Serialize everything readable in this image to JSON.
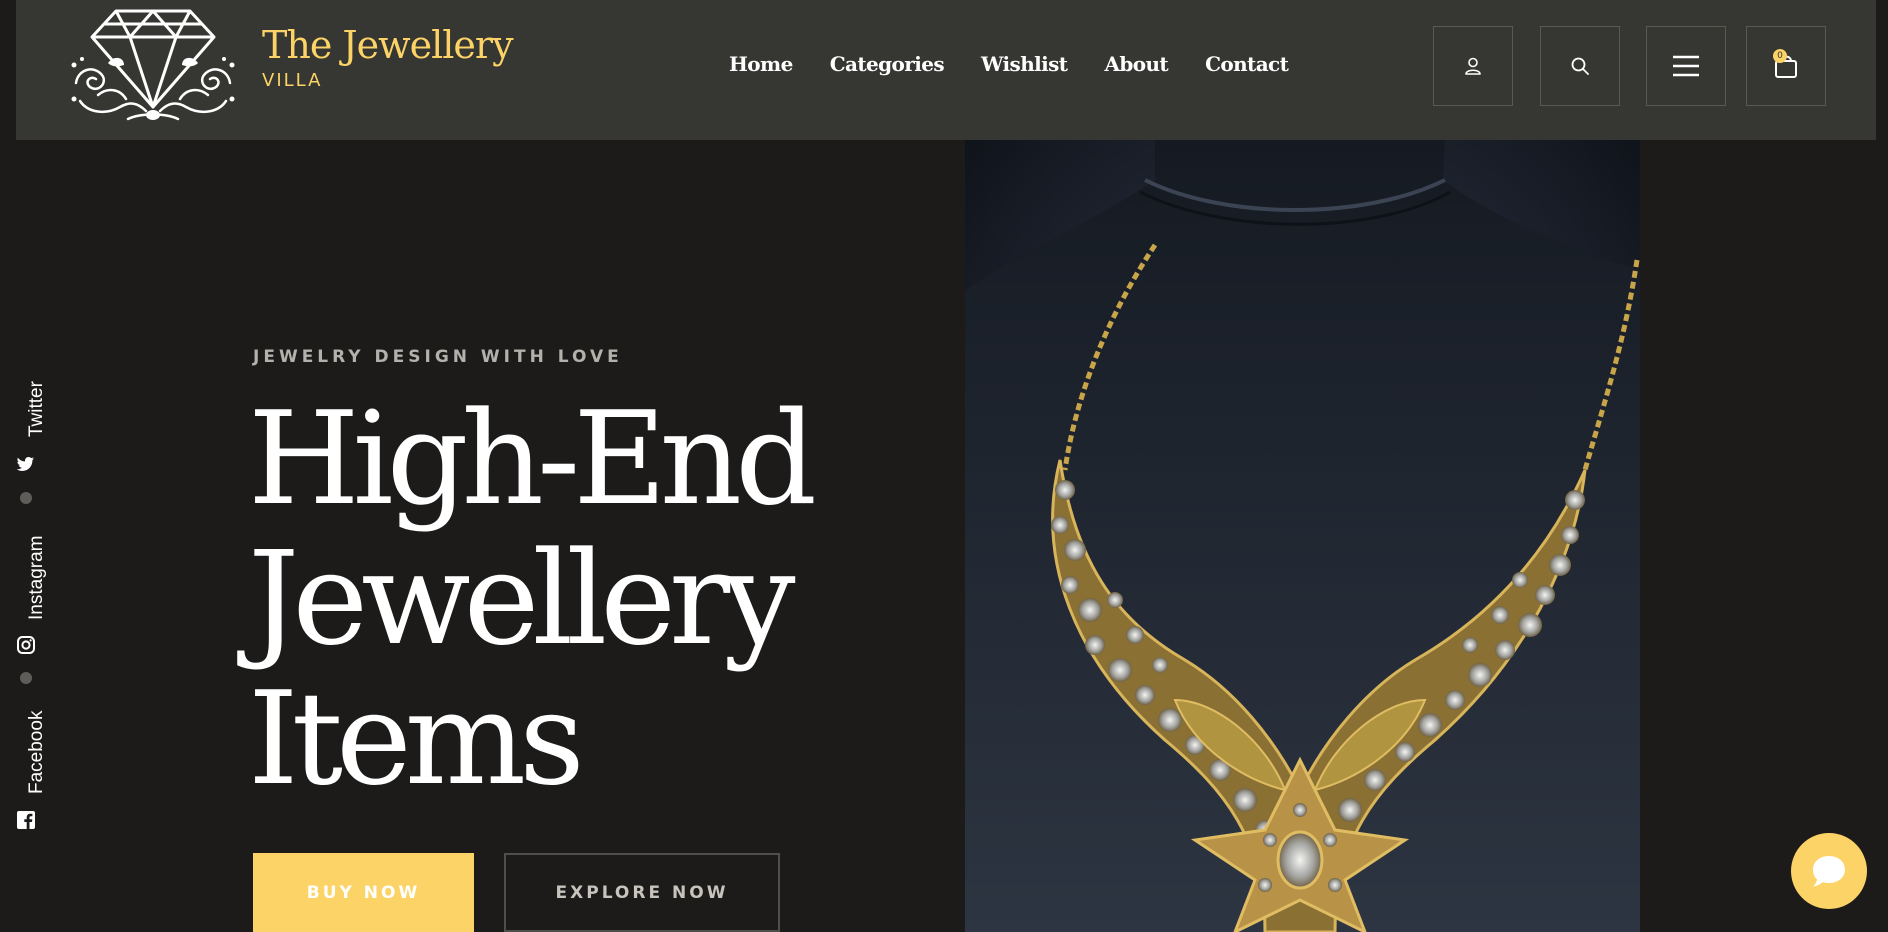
{
  "brand": {
    "title": "The Jewellery",
    "subtitle": "VILLA",
    "accent_color": "#fcd366",
    "logo_icon": "diamond-logo-icon"
  },
  "nav": {
    "items": [
      {
        "label": "Home"
      },
      {
        "label": "Categories"
      },
      {
        "label": "Wishlist"
      },
      {
        "label": "About"
      },
      {
        "label": "Contact"
      }
    ]
  },
  "header_icons": {
    "account": "user-icon",
    "search": "search-icon",
    "menu": "hamburger-menu-icon",
    "cart": "shopping-bag-icon",
    "cart_count": "0"
  },
  "social": {
    "items": [
      {
        "label": "Twitter",
        "icon": "twitter-icon"
      },
      {
        "label": "Instagram",
        "icon": "instagram-icon"
      },
      {
        "label": "Facebook",
        "icon": "facebook-icon"
      }
    ]
  },
  "hero": {
    "tagline": "JEWELRY DESIGN WITH LOVE",
    "headline_lines": [
      "High-End",
      "Jewellery",
      "Items"
    ],
    "buy_label": "BUY NOW",
    "explore_label": "EXPLORE NOW",
    "image": "necklace-on-bust-image"
  },
  "chat": {
    "icon": "chat-bubble-icon"
  }
}
